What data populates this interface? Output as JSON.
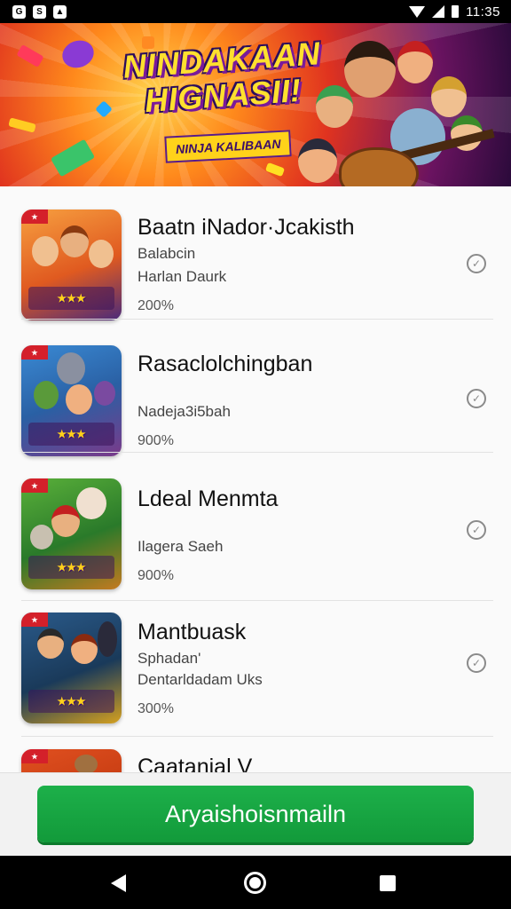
{
  "status_bar": {
    "time": "11:35",
    "left_icons": [
      "notification-icon",
      "sync-icon",
      "file-icon"
    ]
  },
  "banner": {
    "title": "NINDAKAAN HIGNASII!",
    "subtitle": "NINJA KALIBAAN"
  },
  "games": [
    {
      "title": "Baatn iNador·Jcakisth",
      "lines": [
        "Balabcin",
        "Harlan Daurk"
      ],
      "percent": "200%",
      "colors": [
        "#f07a22",
        "#4a2a7a"
      ]
    },
    {
      "title": "Rasaclolchingban",
      "lines": [
        "Nadeja3i5bah"
      ],
      "percent": "900%",
      "colors": [
        "#2a74c4",
        "#e04020"
      ]
    },
    {
      "title": "Ldeal Menmta",
      "lines": [
        "Ilagera Saeh"
      ],
      "percent": "900%",
      "colors": [
        "#3d8a2a",
        "#c42020"
      ]
    },
    {
      "title": "Mantbuask",
      "lines": [
        "Sphadan'",
        "Dentarldadam Uks"
      ],
      "percent": "300%",
      "colors": [
        "#1f4a6a",
        "#d4a020"
      ]
    },
    {
      "title": "Caatanial V",
      "lines": [],
      "percent": "",
      "colors": [
        "#e05020",
        "#2a7a2a"
      ]
    }
  ],
  "action_button": {
    "label": "Aryaishoisnmailn"
  },
  "nav": {
    "back": "back-icon",
    "home": "home-icon",
    "recents": "recents-icon"
  }
}
